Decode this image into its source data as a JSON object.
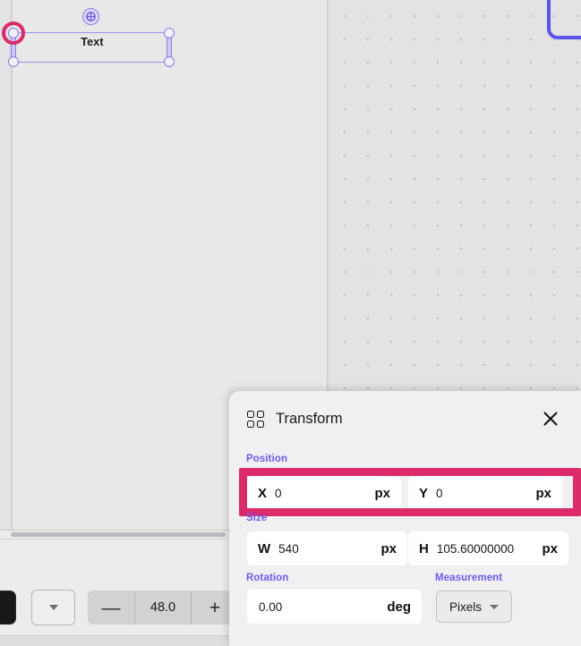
{
  "canvas": {
    "selection": {
      "label": "Text",
      "rotate_icon": "rotate-handle-icon"
    }
  },
  "toolbar": {
    "color_swatch_name": "color-swatch",
    "dropdown_icon": "chevron-down-icon",
    "decrease_label": "—",
    "increase_label": "+",
    "value": "48.0"
  },
  "panel": {
    "icon": "grid-2x2-icon",
    "title": "Transform",
    "close_icon": "close-icon",
    "groups": {
      "position": {
        "label": "Position",
        "x": {
          "prefix": "X",
          "value": "0",
          "suffix": "px"
        },
        "y": {
          "prefix": "Y",
          "value": "0",
          "suffix": "px"
        }
      },
      "size": {
        "label": "Size",
        "w": {
          "prefix": "W",
          "value": "540",
          "suffix": "px"
        },
        "h": {
          "prefix": "H",
          "value": "105.60000000",
          "suffix": "px"
        }
      },
      "rotation": {
        "label": "Rotation",
        "value": "0.00",
        "suffix": "deg"
      },
      "measurement": {
        "label": "Measurement",
        "selected": "Pixels",
        "caret_icon": "chevron-down-icon"
      }
    }
  },
  "colors": {
    "label_purple": "#6b5be8",
    "highlight_pink": "#db2b6a",
    "selection_purple": "#8a7ee6",
    "panel_bg": "#f0f0f2"
  }
}
